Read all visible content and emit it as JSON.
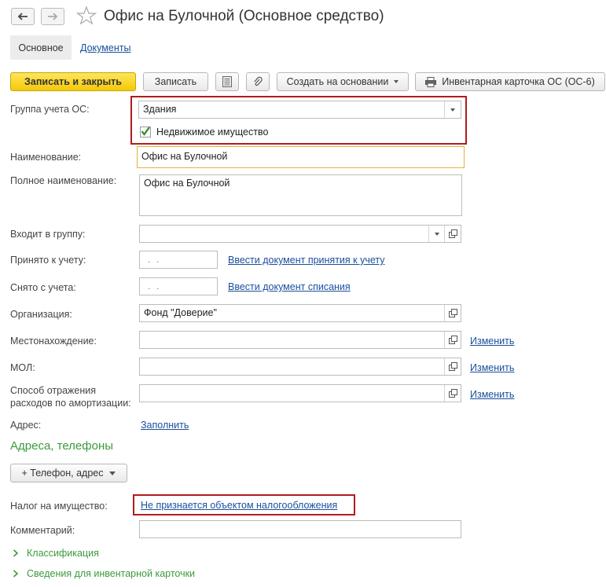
{
  "window": {
    "title": "Офис на Булочной (Основное средство)"
  },
  "tabs": [
    {
      "label": "Основное"
    },
    {
      "label": "Документы"
    }
  ],
  "toolbar": {
    "save_close": "Записать и закрыть",
    "save": "Записать",
    "create_based": "Создать на основании",
    "inventory_card": "Инвентарная карточка ОС (ОС-6)"
  },
  "form": {
    "group_label": "Группа учета ОС:",
    "group_value": "Здания",
    "real_estate_label": "Недвижимое имущество",
    "real_estate_checked": true,
    "name_label": "Наименование:",
    "name_value": "Офис на Булочной",
    "full_name_label": "Полное наименование:",
    "full_name_value": "Офис на Булочной",
    "parent_group_label": "Входит в группу:",
    "parent_group_value": "",
    "accepted_label": "Принято к учету:",
    "accepted_date": ". .",
    "accepted_link": "Ввести документ принятия к учету",
    "removed_label": "Снято с учета:",
    "removed_date": ". .",
    "removed_link": "Ввести документ списания",
    "org_label": "Организация:",
    "org_value": "Фонд \"Доверие\"",
    "location_label": "Местонахождение:",
    "location_value": "",
    "mol_label": "МОЛ:",
    "mol_value": "",
    "amort_label_1": "Способ отражения",
    "amort_label_2": "расходов по амортизации:",
    "amort_value": "",
    "change_link": "Изменить",
    "address_label": "Адрес:",
    "address_link": "Заполнить",
    "contacts_section": "Адреса, телефоны",
    "phone_button": "+ Телефон, адрес",
    "tax_label": "Налог на имущество:",
    "tax_link": "Не признается объектом налогообложения",
    "comment_label": "Комментарий:",
    "comment_value": "",
    "classification": "Классификация",
    "inventory_info": "Сведения для инвентарной карточки"
  },
  "colors": {
    "primary_button": "#f5c907",
    "highlight_border": "#b01c1c",
    "section_green": "#3c9a3c",
    "link": "#1a4f9c"
  }
}
